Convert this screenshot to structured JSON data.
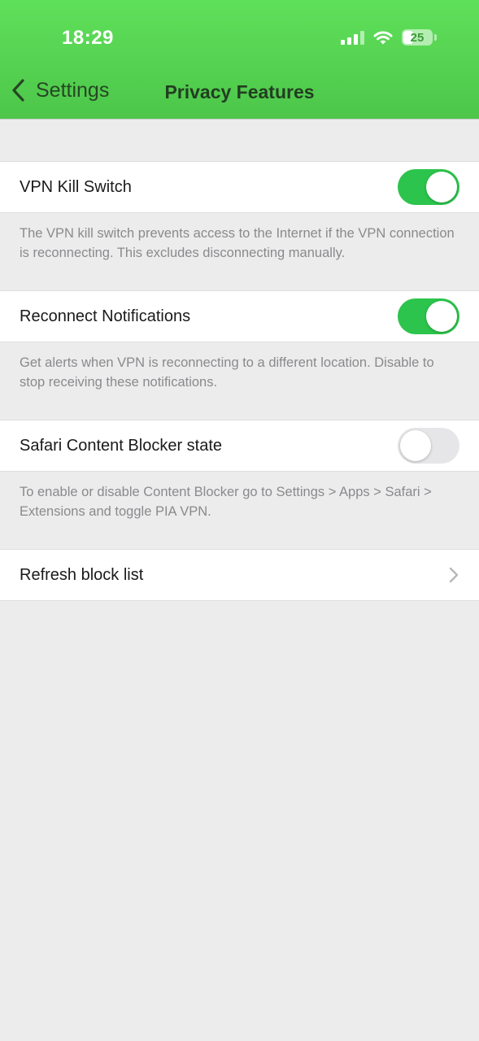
{
  "status_bar": {
    "time": "18:29",
    "battery": "25",
    "signal_icon": "cellular-signal-icon",
    "wifi_icon": "wifi-icon"
  },
  "nav": {
    "back_label": "Settings",
    "title": "Privacy Features"
  },
  "settings": [
    {
      "label": "VPN Kill Switch",
      "type": "toggle",
      "on": true,
      "description": "The VPN kill switch prevents access to the Internet if the VPN connection is reconnecting. This excludes disconnecting manually."
    },
    {
      "label": "Reconnect Notifications",
      "type": "toggle",
      "on": true,
      "description": "Get alerts when VPN is reconnecting to a different location. Disable to stop receiving these notifications."
    },
    {
      "label": "Safari Content Blocker state",
      "type": "toggle",
      "on": false,
      "description": "To enable or disable Content Blocker go to Settings > Apps > Safari > Extensions and toggle PIA VPN."
    },
    {
      "label": "Refresh block list",
      "type": "link"
    }
  ],
  "colors": {
    "header_green": "#5fe05a",
    "toggle_on": "#2cc44c",
    "toggle_off": "#e6e6e8",
    "background": "#ececec"
  }
}
